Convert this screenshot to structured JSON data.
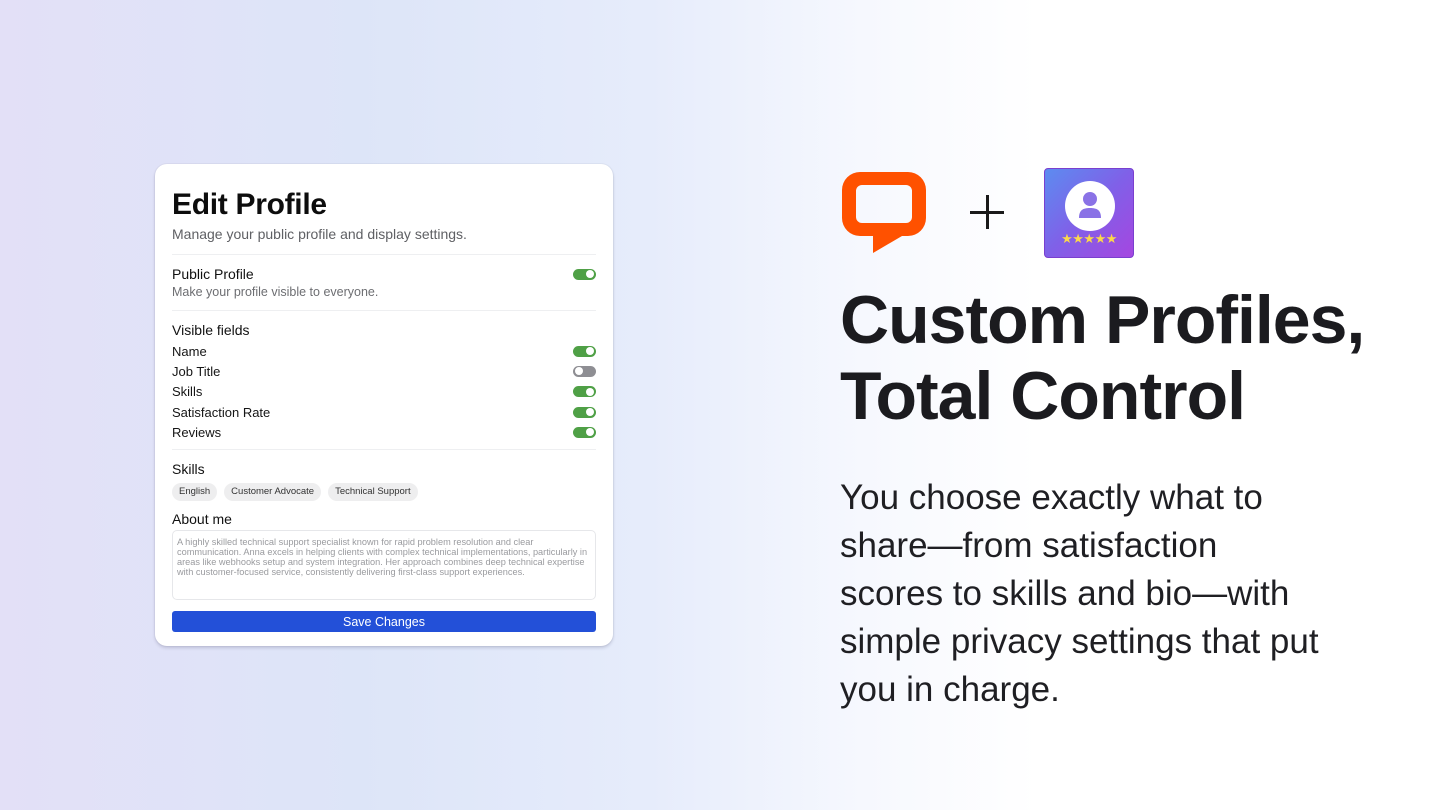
{
  "card": {
    "title": "Edit Profile",
    "subtitle": "Manage your public profile and display settings.",
    "public_profile": {
      "label": "Public Profile",
      "description": "Make your profile visible to everyone.",
      "enabled": true
    },
    "visible_fields": {
      "heading": "Visible fields",
      "items": [
        {
          "label": "Name",
          "enabled": true
        },
        {
          "label": "Job Title",
          "enabled": false
        },
        {
          "label": "Skills",
          "enabled": true
        },
        {
          "label": "Satisfaction Rate",
          "enabled": true
        },
        {
          "label": "Reviews",
          "enabled": true
        }
      ]
    },
    "skills": {
      "heading": "Skills",
      "chips": [
        "English",
        "Customer Advocate",
        "Technical Support"
      ]
    },
    "about": {
      "heading": "About me",
      "text": "A highly skilled technical support specialist known for rapid problem resolution and clear communication. Anna excels in helping clients with complex technical implementations, particularly in areas like webhooks setup and system integration. Her approach combines deep technical expertise with customer-focused service, consistently delivering first-class support experiences."
    },
    "save_label": "Save Changes"
  },
  "promo": {
    "logo_left": "livechat-bubble-icon",
    "plus": "+",
    "logo_right": "profile-rating-app-icon",
    "stars": "★★★★★",
    "headline_line1": "Custom Profiles,",
    "headline_line2": "Total Control",
    "body": "You choose exactly what to share—from satisfaction scores to skills and bio—with simple privacy settings that put you in charge."
  },
  "colors": {
    "toggle_on": "#4fa046",
    "toggle_off": "#8e8e93",
    "button": "#2350d8",
    "logo_orange": "#ff5100"
  }
}
